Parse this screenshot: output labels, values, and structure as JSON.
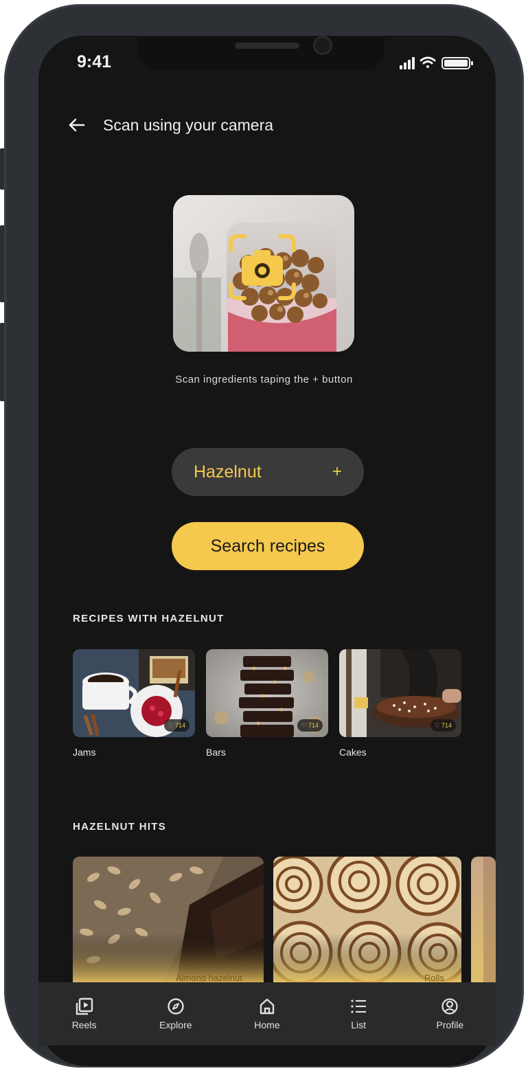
{
  "status_bar": {
    "time": "9:41"
  },
  "header": {
    "title": "Scan using your camera"
  },
  "scan": {
    "hint": "Scan ingredients taping the + button"
  },
  "ingredient_chip": {
    "label": "Hazelnut",
    "plus": "+"
  },
  "search_button": {
    "label": "Search recipes"
  },
  "recipes_section": {
    "title": "RECIPES WITH HAZELNUT",
    "items": [
      {
        "label": "Jams",
        "likes": "714"
      },
      {
        "label": "Bars",
        "likes": "714"
      },
      {
        "label": "Cakes",
        "likes": "714"
      }
    ]
  },
  "hits_section": {
    "title": "HAZELNUT HITS",
    "items": [
      {
        "label": "Almond hazelnut"
      },
      {
        "label": "Rolls"
      }
    ]
  },
  "tabbar": {
    "items": [
      {
        "label": "Reels",
        "icon": "reels-icon"
      },
      {
        "label": "Explore",
        "icon": "compass-icon"
      },
      {
        "label": "Home",
        "icon": "home-icon"
      },
      {
        "label": "List",
        "icon": "list-icon"
      },
      {
        "label": "Profile",
        "icon": "profile-icon"
      }
    ]
  },
  "colors": {
    "accent": "#f5c84e",
    "background": "#151515",
    "tabbar": "#2a2a2a",
    "chip": "#3a3a3a"
  }
}
